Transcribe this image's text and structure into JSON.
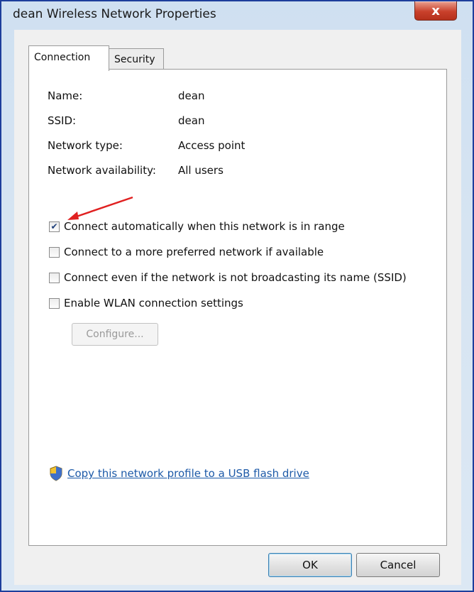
{
  "window": {
    "title": "dean Wireless Network Properties",
    "close_glyph": "x"
  },
  "tabs": [
    {
      "label": "Connection",
      "active": true
    },
    {
      "label": "Security",
      "active": false
    }
  ],
  "info": [
    {
      "label": "Name:",
      "value": "dean"
    },
    {
      "label": "SSID:",
      "value": "dean"
    },
    {
      "label": "Network type:",
      "value": "Access point"
    },
    {
      "label": "Network availability:",
      "value": "All users"
    }
  ],
  "options": [
    {
      "label": "Connect automatically when this network is in range",
      "checked": true
    },
    {
      "label": "Connect to a more preferred network if available",
      "checked": false
    },
    {
      "label": "Connect even if the network is not broadcasting its name (SSID)",
      "checked": false
    },
    {
      "label": "Enable WLAN connection settings",
      "checked": false
    }
  ],
  "configure_button": {
    "label": "Configure...",
    "enabled": false
  },
  "usb_link": {
    "label": "Copy this network profile to a USB flash drive",
    "icon": "shield-icon"
  },
  "buttons": {
    "ok": "OK",
    "cancel": "Cancel"
  },
  "colors": {
    "frame_border": "#1d3e9c",
    "close_button": "#c9402b",
    "link": "#1d5aa8",
    "annotation_arrow": "#e02020",
    "check_mark": "#1f3f7a"
  }
}
